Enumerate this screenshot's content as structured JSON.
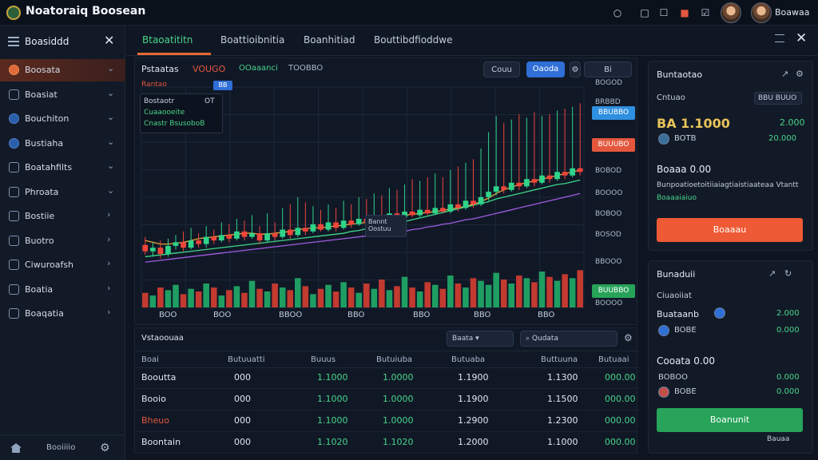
{
  "app": {
    "title": "Noatoraiq Boosean",
    "user_name": "Boawaa"
  },
  "topbar": {
    "icons": [
      "search-icon",
      "chat-icon",
      "gift-icon",
      "notifications-icon"
    ]
  },
  "sidebar": {
    "header_label": "Boasiddd",
    "items": [
      {
        "label": "Boosata",
        "icon": "dashboard-icon",
        "active": true
      },
      {
        "label": "Boasiat",
        "icon": "wallet-icon"
      },
      {
        "label": "Bouchiton",
        "icon": "globe-icon"
      },
      {
        "label": "Bustiaha",
        "icon": "coin-icon"
      },
      {
        "label": "Boatahfilts",
        "icon": "document-icon"
      },
      {
        "label": "Phroata",
        "icon": "calendar-icon"
      },
      {
        "label": "Bostiie",
        "icon": "mail-icon"
      },
      {
        "label": "Buotro",
        "icon": "shield-icon"
      },
      {
        "label": "Ciwuroafsh",
        "icon": "list-icon"
      },
      {
        "label": "Boatia",
        "icon": "briefcase-icon"
      },
      {
        "label": "Boaqatia",
        "icon": "settings-icon"
      }
    ],
    "footer_label": "Booiiiio"
  },
  "tabs": {
    "items": [
      "Btaoatititn",
      "Boattioibnitia",
      "Boanhitiad",
      "Bouttibdfioddwe"
    ],
    "active_index": 0
  },
  "chart_panel": {
    "title": "Pstaatas",
    "pair": "VOUGO",
    "pair_secondary": "OOaaanci",
    "change": "TOOBBO",
    "tool_buttons": [
      "Couu",
      "Oaoda",
      "Bi"
    ],
    "indicator_tag": "Rantao",
    "indicator_badge": "BB",
    "indicators": [
      {
        "label": "Bostaotr",
        "value": "OT",
        "color": "#c9d3e3"
      },
      {
        "label": "Cuaaooeite",
        "value": "",
        "color": "#4ad48a"
      },
      {
        "label": "Cnastr BsusoboB",
        "value": "",
        "color": "#4ad48a"
      }
    ],
    "tooltip": [
      "Bannt",
      "Oostuu"
    ],
    "price_labels": [
      "BOGOD",
      "BRBBD",
      "BOBOD",
      "BOOOO",
      "BOBOO",
      "BOSOD",
      "BBOOO",
      "BOOOO"
    ],
    "price_tags": [
      {
        "label": "BBUBBO",
        "color": "#2f8fe0"
      },
      {
        "label": "BUUUBO",
        "color": "#e4573d"
      },
      {
        "label": "BUUBBO",
        "color": "#27a35a"
      }
    ],
    "x_labels": [
      "BOO",
      "BOO",
      "BBOO",
      "BBO",
      "BBO",
      "BBO",
      "BBO"
    ],
    "colors": {
      "up": "#2fd38a",
      "down": "#f0453a",
      "ma_orange": "#e8a33a",
      "ma_green": "#3fd68a",
      "ma_purple": "#a05ce0"
    }
  },
  "chart_data": {
    "type": "candlestick",
    "title": "",
    "candles": [
      [
        25,
        18,
        34,
        14
      ],
      [
        18,
        22,
        28,
        12
      ],
      [
        22,
        15,
        30,
        10
      ],
      [
        15,
        24,
        32,
        12
      ],
      [
        24,
        28,
        36,
        20
      ],
      [
        28,
        22,
        40,
        18
      ],
      [
        22,
        30,
        44,
        20
      ],
      [
        30,
        26,
        38,
        22
      ],
      [
        26,
        34,
        46,
        22
      ],
      [
        34,
        30,
        42,
        26
      ],
      [
        30,
        36,
        50,
        28
      ],
      [
        36,
        32,
        48,
        28
      ],
      [
        32,
        40,
        54,
        30
      ],
      [
        40,
        34,
        52,
        30
      ],
      [
        34,
        38,
        58,
        32
      ],
      [
        38,
        30,
        46,
        26
      ],
      [
        30,
        38,
        60,
        28
      ],
      [
        38,
        34,
        50,
        30
      ],
      [
        34,
        42,
        66,
        32
      ],
      [
        42,
        36,
        70,
        32
      ],
      [
        36,
        44,
        78,
        34
      ],
      [
        44,
        40,
        72,
        36
      ],
      [
        40,
        48,
        68,
        38
      ],
      [
        48,
        42,
        64,
        40
      ],
      [
        42,
        50,
        70,
        40
      ],
      [
        50,
        44,
        66,
        40
      ],
      [
        44,
        52,
        74,
        42
      ],
      [
        52,
        48,
        70,
        44
      ],
      [
        48,
        54,
        78,
        46
      ],
      [
        54,
        50,
        76,
        46
      ],
      [
        50,
        58,
        82,
        48
      ],
      [
        58,
        52,
        80,
        50
      ],
      [
        52,
        60,
        88,
        50
      ],
      [
        60,
        56,
        86,
        52
      ],
      [
        56,
        62,
        92,
        54
      ],
      [
        62,
        58,
        98,
        56
      ],
      [
        58,
        64,
        96,
        56
      ],
      [
        64,
        60,
        100,
        58
      ],
      [
        60,
        66,
        104,
        58
      ],
      [
        66,
        62,
        100,
        60
      ],
      [
        62,
        70,
        108,
        60
      ],
      [
        70,
        66,
        112,
        62
      ],
      [
        66,
        74,
        116,
        64
      ],
      [
        74,
        70,
        120,
        66
      ],
      [
        70,
        78,
        132,
        68
      ],
      [
        78,
        84,
        150,
        74
      ],
      [
        84,
        90,
        168,
        80
      ],
      [
        90,
        86,
        160,
        82
      ],
      [
        86,
        94,
        164,
        84
      ],
      [
        94,
        90,
        170,
        86
      ],
      [
        90,
        98,
        166,
        88
      ],
      [
        98,
        94,
        172,
        90
      ],
      [
        94,
        102,
        168,
        92
      ],
      [
        102,
        98,
        170,
        94
      ],
      [
        98,
        106,
        174,
        96
      ],
      [
        106,
        102,
        176,
        98
      ],
      [
        102,
        110,
        178,
        100
      ],
      [
        110,
        106,
        182,
        102
      ]
    ],
    "volumes": [
      22,
      18,
      30,
      26,
      34,
      20,
      28,
      24,
      36,
      30,
      18,
      26,
      32,
      22,
      40,
      28,
      24,
      36,
      30,
      26,
      44,
      32,
      20,
      28,
      34,
      24,
      38,
      30,
      22,
      36,
      28,
      42,
      26,
      32,
      46,
      30,
      24,
      38,
      34,
      28,
      48,
      36,
      30,
      44,
      40,
      34,
      52,
      42,
      36,
      48,
      44,
      38,
      54,
      46,
      40,
      50,
      44,
      56
    ],
    "moving_averages": [
      {
        "values": [
          30,
          28,
          26,
          26,
          27,
          28,
          30,
          32,
          33,
          34,
          35,
          36,
          37,
          38,
          38,
          37,
          37,
          38,
          39,
          40,
          42,
          43,
          44,
          44,
          45,
          46,
          47,
          48,
          49,
          50,
          52,
          53,
          55,
          56,
          58,
          59,
          60,
          61,
          62,
          63,
          65,
          66,
          68,
          70,
          73,
          77,
          82,
          86,
          89,
          92,
          94,
          96,
          98,
          100,
          102,
          104,
          106,
          108
        ]
      },
      {
        "values": [
          12,
          13,
          14,
          15,
          16,
          17,
          18,
          19,
          20,
          21,
          22,
          23,
          24,
          25,
          26,
          27,
          28,
          29,
          30,
          31,
          32,
          33,
          34,
          35,
          36,
          37,
          38,
          40,
          41,
          43,
          44,
          46,
          48,
          49,
          51,
          53,
          55,
          57,
          59,
          61,
          63,
          65,
          67,
          69,
          71,
          73,
          76,
          78,
          80,
          82,
          84,
          86,
          88,
          90,
          92,
          93,
          95,
          97
        ]
      },
      {
        "values": [
          6,
          7,
          8,
          9,
          10,
          11,
          12,
          13,
          14,
          15,
          16,
          17,
          18,
          19,
          20,
          21,
          22,
          23,
          24,
          25,
          26,
          27,
          28,
          29,
          30,
          31,
          32,
          33,
          34,
          35,
          36,
          37,
          38,
          39,
          40,
          42,
          43,
          45,
          46,
          48,
          49,
          51,
          53,
          54,
          56,
          58,
          60,
          62,
          64,
          66,
          68,
          70,
          72,
          74,
          76,
          78,
          80,
          82
        ]
      }
    ],
    "ylim": [
      0,
      200
    ],
    "x_labels": [
      "BOO",
      "BOO",
      "BBOO",
      "BBO",
      "BBO",
      "BBO",
      "BBO"
    ]
  },
  "table": {
    "title": "Vstaoouaa",
    "controls": [
      "Baata",
      "Qudata"
    ],
    "headers": [
      "Boai",
      "Butuuatti",
      "Buuus",
      "Butuiuba",
      "Butuaba",
      "Buttuuna",
      "Butuaai"
    ],
    "rows": [
      {
        "name": "Booutta",
        "name_color": "#dfe6f0",
        "cells": [
          "000",
          "1.1000",
          "1.0000",
          "1.1900",
          "1.1300",
          "000.00"
        ]
      },
      {
        "name": "Booio",
        "name_color": "#dfe6f0",
        "cells": [
          "000",
          "1.1000",
          "1.0000",
          "1.1900",
          "1.1500",
          "000.00"
        ]
      },
      {
        "name": "Bheuo",
        "name_color": "#e4573d",
        "cells": [
          "000",
          "1.1000",
          "1.0000",
          "1.2900",
          "1.2300",
          "000.00"
        ]
      },
      {
        "name": "Boontain",
        "name_color": "#dfe6f0",
        "cells": [
          "000",
          "1.1020",
          "1.1020",
          "1.2000",
          "1.1000",
          "000.00"
        ]
      }
    ]
  },
  "order_card": {
    "title": "Buntaotao",
    "sub_label": "Cntuao",
    "sub_select": "BBU BUUO",
    "price": "BA 1.1000",
    "price_change": "2.000",
    "coin_label": "BOTB",
    "coin_value": "20.000",
    "section_title": "Boaaa 0.00",
    "section_text": "Bunpoatioetoitiiaiagtiaistiaateaa Vtantt",
    "section_green": "Boaaaiaiuo",
    "button_label": "Boaaau"
  },
  "wallet_card": {
    "title": "Bunaduii",
    "sub_label": "Ciuaoiiat",
    "asset_label": "Buataanb",
    "asset1_value": "2.000",
    "asset2_label": "BOBE",
    "asset2_value": "0.000",
    "section_title": "Cooata 0.00",
    "row1_label": "BOBOO",
    "row1_value": "0.000",
    "row2_label": "BOBE",
    "row2_value": "0.000",
    "button_label": "Boanunit",
    "footer": "Bauaa"
  }
}
